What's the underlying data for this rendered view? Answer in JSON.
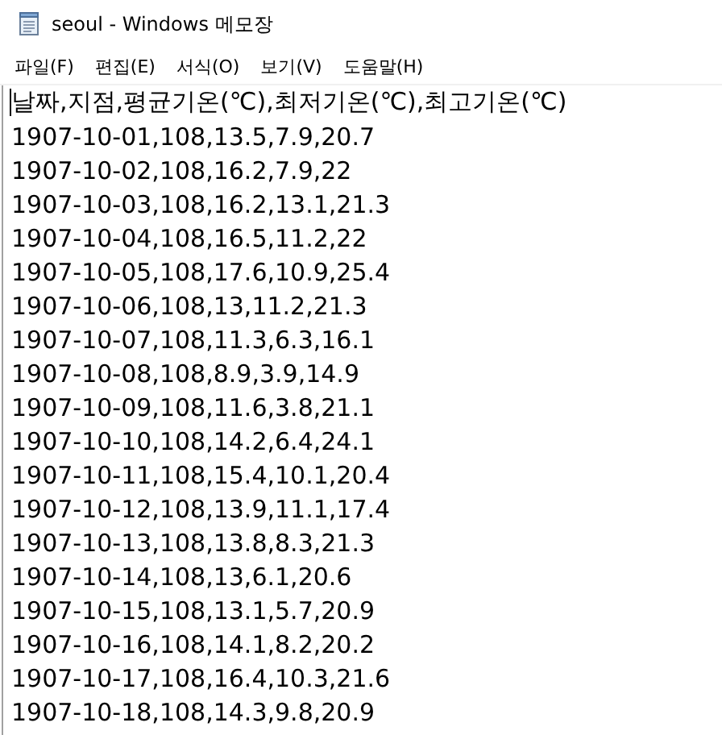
{
  "window": {
    "title": "seoul - Windows 메모장"
  },
  "menu": [
    "파일(F)",
    "편집(E)",
    "서식(O)",
    "보기(V)",
    "도움말(H)"
  ],
  "lines": [
    "날짜,지점,평균기온(℃),최저기온(℃),최고기온(℃)",
    "1907-10-01,108,13.5,7.9,20.7",
    "1907-10-02,108,16.2,7.9,22",
    "1907-10-03,108,16.2,13.1,21.3",
    "1907-10-04,108,16.5,11.2,22",
    "1907-10-05,108,17.6,10.9,25.4",
    "1907-10-06,108,13,11.2,21.3",
    "1907-10-07,108,11.3,6.3,16.1",
    "1907-10-08,108,8.9,3.9,14.9",
    "1907-10-09,108,11.6,3.8,21.1",
    "1907-10-10,108,14.2,6.4,24.1",
    "1907-10-11,108,15.4,10.1,20.4",
    "1907-10-12,108,13.9,11.1,17.4",
    "1907-10-13,108,13.8,8.3,21.3",
    "1907-10-14,108,13,6.1,20.6",
    "1907-10-15,108,13.1,5.7,20.9",
    "1907-10-16,108,14.1,8.2,20.2",
    "1907-10-17,108,16.4,10.3,21.6",
    "1907-10-18,108,14.3,9.8,20.9"
  ]
}
